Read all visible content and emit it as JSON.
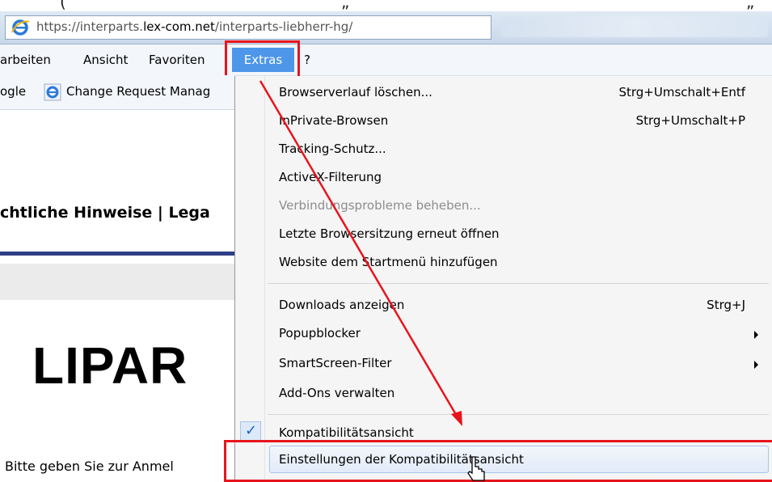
{
  "browser": {
    "url_prefix": "https://interparts.",
    "url_domain": "lex-com.net",
    "url_path": "/interparts-liebherr-hg/"
  },
  "menubar": {
    "items": [
      "arbeiten",
      "Ansicht",
      "Favoriten",
      "Extras",
      "?"
    ],
    "active": "Extras"
  },
  "favorites": {
    "google": "ogle",
    "change_request": "Change Request Manag"
  },
  "page": {
    "legal": "chtliche Hinweise | Lega",
    "logo": "LIPAR",
    "login_prompt": "Bitte geben Sie zur Anmel"
  },
  "dropdown": {
    "items": [
      {
        "label": "Browserverlauf löschen...",
        "shortcut": "Strg+Umschalt+Entf"
      },
      {
        "label": "InPrivate-Browsen",
        "shortcut": "Strg+Umschalt+P"
      },
      {
        "label": "Tracking-Schutz...",
        "shortcut": ""
      },
      {
        "label": "ActiveX-Filterung",
        "shortcut": ""
      },
      {
        "label": "Verbindungsprobleme beheben...",
        "shortcut": "",
        "disabled": true
      },
      {
        "label": "Letzte Browsersitzung erneut öffnen",
        "shortcut": ""
      },
      {
        "label": "Website dem Startmenü hinzufügen",
        "shortcut": ""
      },
      {
        "label": "Downloads anzeigen",
        "shortcut": "Strg+J"
      },
      {
        "label": "Popupblocker",
        "shortcut": "",
        "submenu": true
      },
      {
        "label": "SmartScreen-Filter",
        "shortcut": "",
        "submenu": true
      },
      {
        "label": "Add-Ons verwalten",
        "shortcut": ""
      },
      {
        "label": "Kompatibilitätsansicht",
        "shortcut": "",
        "checked": true
      },
      {
        "label": "Einstellungen der Kompatibilitätsansicht",
        "shortcut": "",
        "hovered": true
      }
    ]
  },
  "colors": {
    "highlight_red": "#e8141c",
    "extras_blue": "#4d96e9",
    "rule_blue": "#2f3f86"
  }
}
